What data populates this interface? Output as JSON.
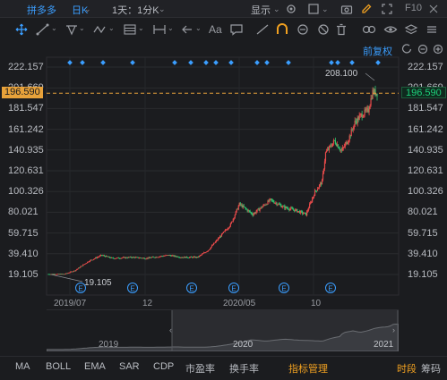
{
  "topbar": {
    "stock_name": "拼多多",
    "period": "日K",
    "interval": "1天：1分K",
    "display_label": "显示",
    "f10_label": "F10"
  },
  "subrow": {
    "adjust_label": "前复权"
  },
  "chart": {
    "y_labels": [
      "222.157",
      "201.669",
      "181.547",
      "161.242",
      "140.935",
      "120.631",
      "100.326",
      "80.021",
      "59.715",
      "39.410",
      "19.105"
    ],
    "current_price": "196.590",
    "high_label": "208.100",
    "low_label": "19.105",
    "x_labels": [
      "2019/07",
      "12",
      "2020/05",
      "10"
    ],
    "event_marker": "E",
    "colors": {
      "up": "#e74a4a",
      "down": "#2ec46e",
      "price_line": "#e8a23a",
      "accent": "#f0a020",
      "link": "#3b9eff"
    }
  },
  "navigator": {
    "labels": [
      "2019",
      "2020",
      "2021"
    ]
  },
  "bottombar": {
    "indicators": [
      "MA",
      "BOLL",
      "EMA",
      "SAR",
      "CDP",
      "市盈率",
      "换手率"
    ],
    "manage_label": "指标管理",
    "right_labels": [
      "时段",
      "筹码"
    ]
  }
}
